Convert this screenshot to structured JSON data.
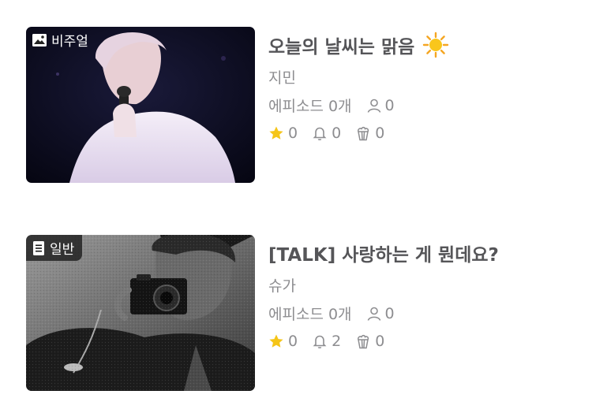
{
  "stories": [
    {
      "badge": "비주얼",
      "badge_icon": "image-icon",
      "title": "오늘의 날씨는 맑음",
      "title_icon": "sun-icon",
      "author": "지민",
      "episodes": "에피소드 0개",
      "subscribers": "0",
      "stars": "0",
      "alerts": "0",
      "popcorn": "0"
    },
    {
      "badge": "일반",
      "badge_icon": "document-icon",
      "title": "[TALK] 사랑하는 게 뭔데요?",
      "author": "슈가",
      "episodes": "에피소드 0개",
      "subscribers": "0",
      "stars": "0",
      "alerts": "2",
      "popcorn": "0"
    }
  ],
  "colors": {
    "title": "#555558",
    "meta": "#8d8d90",
    "star": "#f5c518",
    "badge_bg": "#191919"
  }
}
